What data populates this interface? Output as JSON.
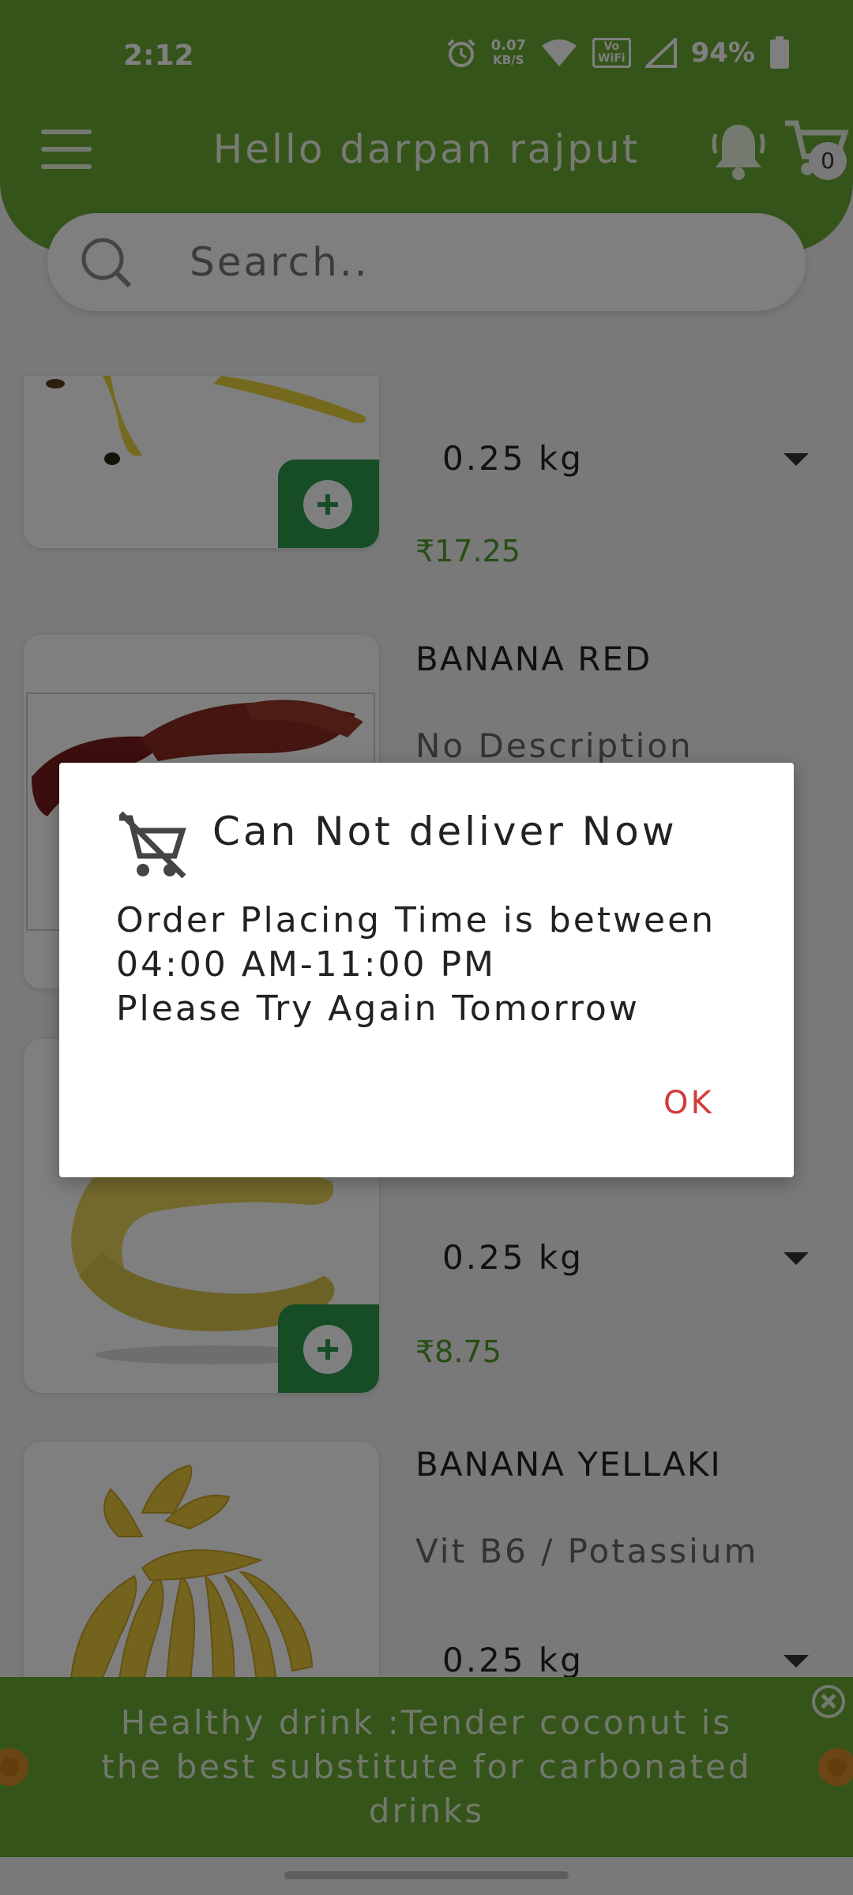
{
  "status_bar": {
    "time": "2:12",
    "speed_value": "0.07",
    "speed_unit": "KB/S",
    "vowifi_top": "Vo",
    "vowifi_bottom": "WiFi",
    "battery": "94%"
  },
  "header": {
    "greeting": "Hello darpan rajput",
    "cart_count": "0"
  },
  "search": {
    "placeholder": "Search.."
  },
  "products": [
    {
      "name": "",
      "description": "",
      "quantity": "0.25 kg",
      "price": "₹17.25"
    },
    {
      "name": "BANANA RED",
      "description": "No Description",
      "quantity": "",
      "price": ""
    },
    {
      "name": "",
      "description": "",
      "quantity": "0.25 kg",
      "price": "₹8.75"
    },
    {
      "name": "BANANA YELLAKI",
      "description": "Vit B6 / Potassium",
      "quantity": "0.25 kg",
      "price": ""
    }
  ],
  "banner": {
    "text": "Healthy drink :Tender coconut is the best substitute for carbonated drinks"
  },
  "dialog": {
    "title": "Can Not deliver Now",
    "message": "Order Placing Time is between\n04:00 AM-11:00 PM\nPlease Try Again Tomorrow",
    "ok_label": "OK"
  },
  "colors": {
    "header_green": "#6aa835",
    "add_button_green": "#2c9b4d",
    "price_green": "#4f9a2a",
    "ok_red": "#d43a3a"
  }
}
